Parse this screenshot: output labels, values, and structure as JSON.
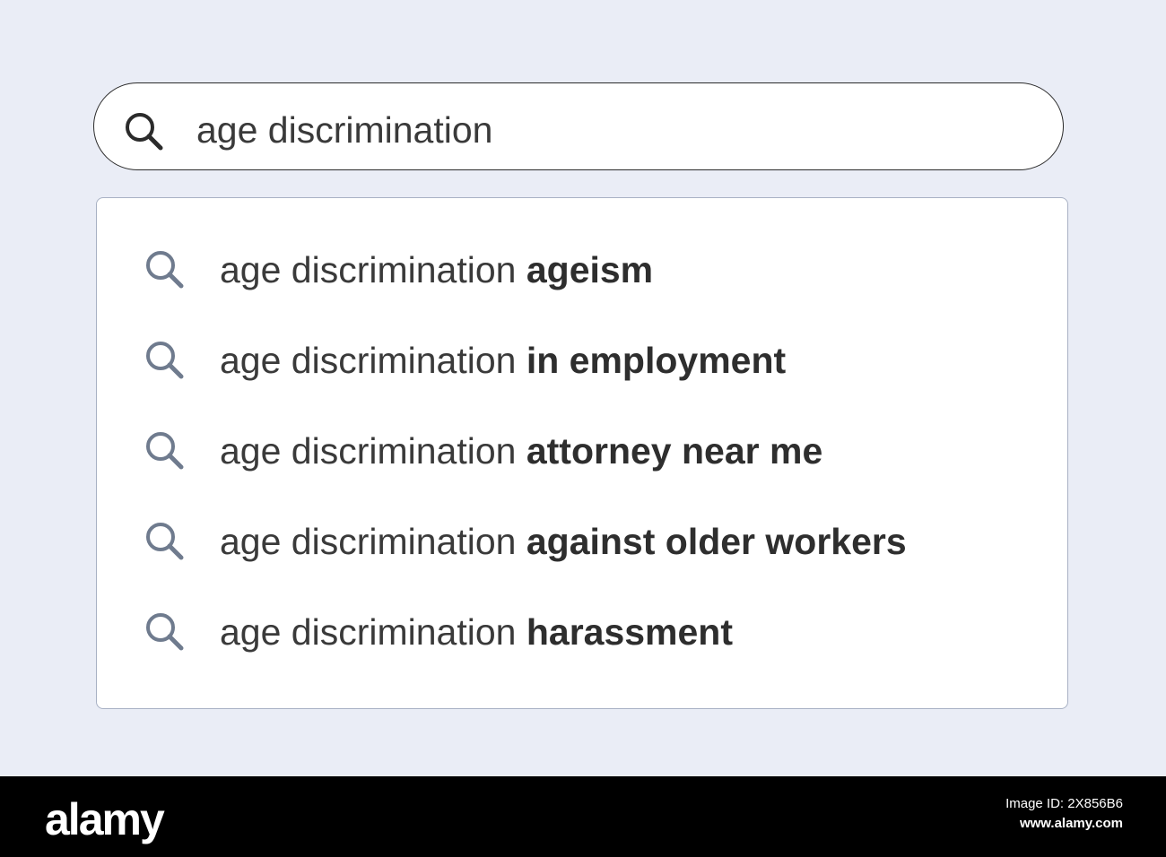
{
  "search": {
    "query": "age discrimination"
  },
  "suggestions": [
    {
      "prefix": "age discrimination ",
      "completion": "ageism"
    },
    {
      "prefix": "age discrimination ",
      "completion": "in employment"
    },
    {
      "prefix": "age discrimination ",
      "completion": "attorney near me"
    },
    {
      "prefix": "age discrimination ",
      "completion": "against older workers"
    },
    {
      "prefix": "age discrimination ",
      "completion": "harassment"
    }
  ],
  "watermark": {
    "brand": "alamy",
    "image_id": "Image ID: 2X856B6",
    "site": "www.alamy.com"
  },
  "icons": {
    "search_bar": "search-icon",
    "suggestion": "search-icon"
  },
  "colors": {
    "background": "#eaedf6",
    "text": "#3a3a3a",
    "suggestion_icon": "#6f7b8e",
    "bar_icon": "#2b2b2b"
  }
}
